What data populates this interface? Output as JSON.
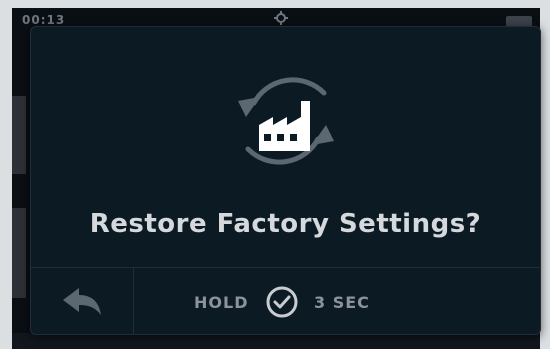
{
  "status_bar": {
    "time": "00:13",
    "gear_icon": "gear-icon",
    "battery_icon": "battery-icon"
  },
  "dialog": {
    "icon": "factory-restore-icon",
    "title": "Restore Factory Settings?",
    "back_icon": "reply-arrow-icon",
    "hold_label": "HOLD",
    "check_icon": "check-circle-icon",
    "duration_label": "3 SEC"
  },
  "colors": {
    "dialog_background": "#0c1a24",
    "title_text": "#d6d9dc",
    "icon_gray": "#5b6872",
    "action_text": "#8c939a"
  }
}
